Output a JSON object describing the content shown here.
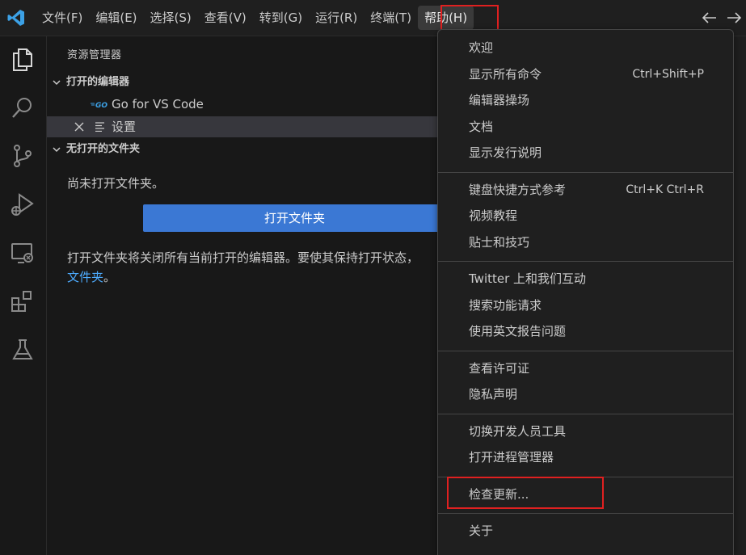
{
  "menubar": {
    "items": [
      "文件(F)",
      "编辑(E)",
      "选择(S)",
      "查看(V)",
      "转到(G)",
      "运行(R)",
      "终端(T)",
      "帮助(H)"
    ],
    "open_menu": "帮助(H)"
  },
  "colors": {
    "background": "#1f1f1f",
    "sidebar": "#181818",
    "accent_button": "#3b78d4",
    "link": "#4daafc",
    "annotation_box": "#e02020",
    "vscode_blue": "#3ca1e6"
  },
  "icons": {
    "logo": "vscode-logo",
    "nav_back": "arrow-left-icon",
    "nav_forward": "arrow-right-icon",
    "activity": [
      "files-icon",
      "search-icon",
      "source-control-icon",
      "run-debug-icon",
      "remote-explorer-icon",
      "extensions-icon",
      "testing-icon"
    ]
  },
  "explorer": {
    "title": "资源管理器",
    "open_editors": {
      "header": "打开的编辑器",
      "items": [
        {
          "label": "Go for VS Code",
          "icon": "go-icon",
          "active": false
        },
        {
          "label": "设置",
          "icon": "settings-file-icon",
          "active": true
        }
      ]
    },
    "no_folder": {
      "header": "无打开的文件夹",
      "message": "尚未打开文件夹。",
      "button": "打开文件夹",
      "info": "打开文件夹将关闭所有当前打开的编辑器。要使其保持打开状态，",
      "info_link": "文件夹",
      "info_tail": "。"
    }
  },
  "help_menu": {
    "groups": [
      [
        {
          "label": "欢迎",
          "shortcut": ""
        },
        {
          "label": "显示所有命令",
          "shortcut": "Ctrl+Shift+P"
        },
        {
          "label": "编辑器操场",
          "shortcut": ""
        },
        {
          "label": "文档",
          "shortcut": ""
        },
        {
          "label": "显示发行说明",
          "shortcut": ""
        }
      ],
      [
        {
          "label": "键盘快捷方式参考",
          "shortcut": "Ctrl+K Ctrl+R"
        },
        {
          "label": "视频教程",
          "shortcut": ""
        },
        {
          "label": "贴士和技巧",
          "shortcut": ""
        }
      ],
      [
        {
          "label": "Twitter 上和我们互动",
          "shortcut": ""
        },
        {
          "label": "搜索功能请求",
          "shortcut": ""
        },
        {
          "label": "使用英文报告问题",
          "shortcut": ""
        }
      ],
      [
        {
          "label": "查看许可证",
          "shortcut": ""
        },
        {
          "label": "隐私声明",
          "shortcut": ""
        }
      ],
      [
        {
          "label": "切换开发人员工具",
          "shortcut": ""
        },
        {
          "label": "打开进程管理器",
          "shortcut": ""
        }
      ],
      [
        {
          "label": "检查更新...",
          "shortcut": "",
          "highlighted": true
        }
      ],
      [
        {
          "label": "关于",
          "shortcut": ""
        }
      ]
    ]
  }
}
